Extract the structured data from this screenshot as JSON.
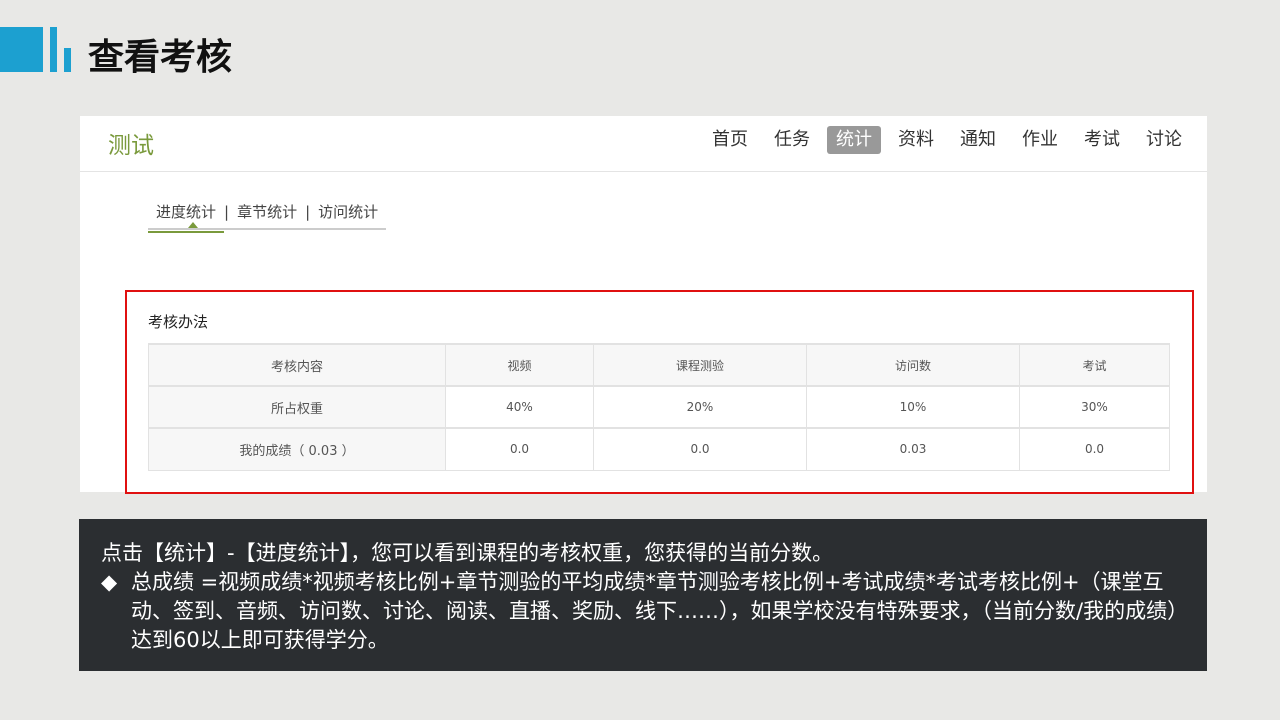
{
  "slide_title": "查看考核",
  "course": "测试",
  "nav": [
    "首页",
    "任务",
    "统计",
    "资料",
    "通知",
    "作业",
    "考试",
    "讨论"
  ],
  "nav_active": 2,
  "subtabs": [
    "进度统计",
    "章节统计",
    "访问统计"
  ],
  "section": "考核办法",
  "table": {
    "header": [
      "考核内容",
      "视频",
      "课程测验",
      "访问数",
      "考试"
    ],
    "rows": [
      [
        "所占权重",
        "40%",
        "20%",
        "10%",
        "30%"
      ],
      [
        "我的成绩（ 0.03 ）",
        "0.0",
        "0.0",
        "0.03",
        "0.0"
      ]
    ]
  },
  "note": {
    "line1": "点击【统计】-【进度统计】，您可以看到课程的考核权重，您获得的当前分数。",
    "bullet": "◆",
    "line2": "总成绩 =视频成绩*视频考核比例+章节测验的平均成绩*章节测验考核比例+考试成绩*考试考核比例+（课堂互动、签到、音频、访问数、讨论、阅读、直播、奖励、线下……），如果学校没有特殊要求，（当前分数/我的成绩）达到60以上即可获得学分。"
  },
  "colors": {
    "accent": "#1ca0d0",
    "green": "#7a9a3c",
    "highlight": "#e01010"
  }
}
